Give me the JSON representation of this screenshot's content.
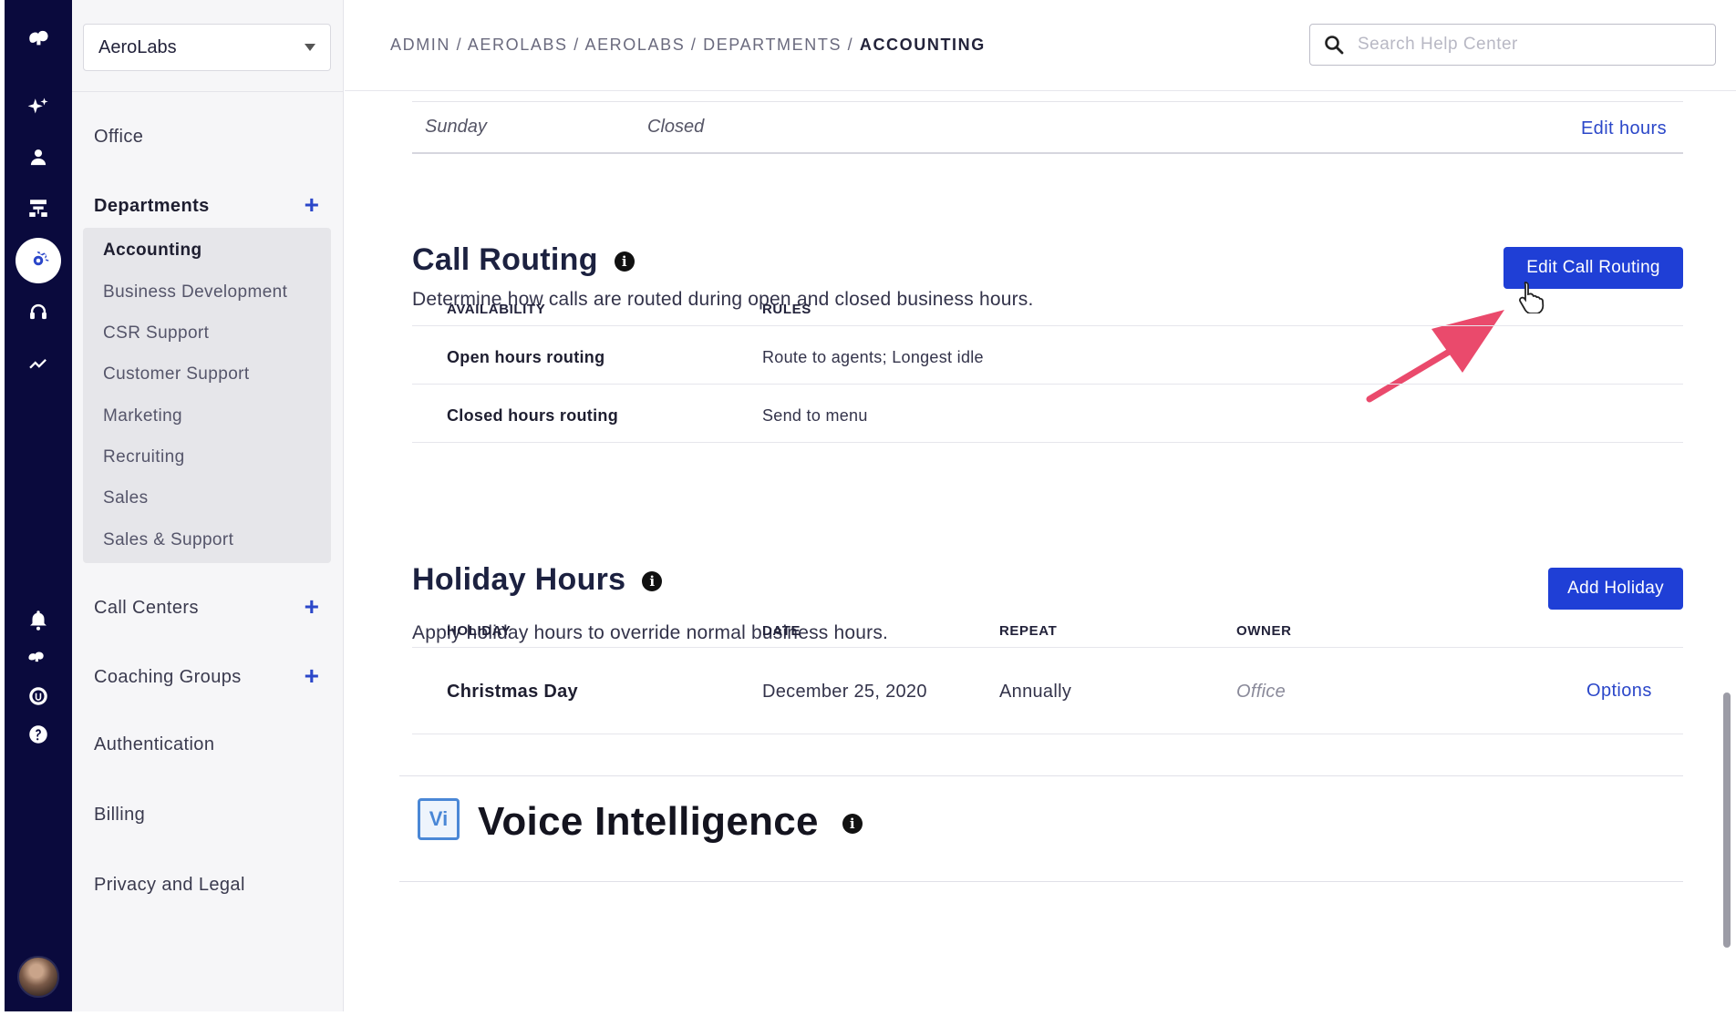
{
  "rail": {
    "items": [
      "logo-icon",
      "sparkle-icon",
      "person-icon",
      "org-chart-icon",
      "settings-icon",
      "headset-icon",
      "trend-icon",
      "bell-icon",
      "brand-icon",
      "lock-badge-icon",
      "help-icon",
      "avatar"
    ]
  },
  "sidebar": {
    "org_name": "AeroLabs",
    "office": "Office",
    "departments_label": "Departments",
    "departments": [
      "Accounting",
      "Business Development",
      "CSR Support",
      "Customer Support",
      "Marketing",
      "Recruiting",
      "Sales",
      "Sales & Support"
    ],
    "call_centers": "Call Centers",
    "coaching_groups": "Coaching Groups",
    "authentication": "Authentication",
    "billing": "Billing",
    "privacy": "Privacy and Legal"
  },
  "header": {
    "breadcrumb_prefix": "ADMIN / AEROLABS / AEROLABS / DEPARTMENTS / ",
    "breadcrumb_current": "ACCOUNTING",
    "search_placeholder": "Search Help Center"
  },
  "hours": {
    "day": "Sunday",
    "value": "Closed",
    "edit_link": "Edit hours"
  },
  "call_routing": {
    "title": "Call Routing",
    "description": "Determine how calls are routed during open and closed business hours.",
    "button": "Edit Call Routing",
    "headers": [
      "AVAILABILITY",
      "RULES"
    ],
    "rows": [
      {
        "availability": "Open hours routing",
        "rules": "Route to agents; Longest idle"
      },
      {
        "availability": "Closed hours routing",
        "rules": "Send to menu"
      }
    ]
  },
  "holiday_hours": {
    "title": "Holiday Hours",
    "description": "Apply holiday hours to override normal business hours.",
    "button": "Add Holiday",
    "headers": [
      "HOLIDAY",
      "DATE",
      "REPEAT",
      "OWNER"
    ],
    "rows": [
      {
        "holiday": "Christmas Day",
        "date": "December 25, 2020",
        "repeat": "Annually",
        "owner": "Office",
        "action": "Options"
      }
    ]
  },
  "voice_intelligence": {
    "badge": "Vi",
    "title": "Voice Intelligence"
  },
  "colors": {
    "rail": "#0a0a3d",
    "accent": "#1f3fd6",
    "link": "#2b47c9",
    "annotation_arrow": "#ea4a6c"
  }
}
